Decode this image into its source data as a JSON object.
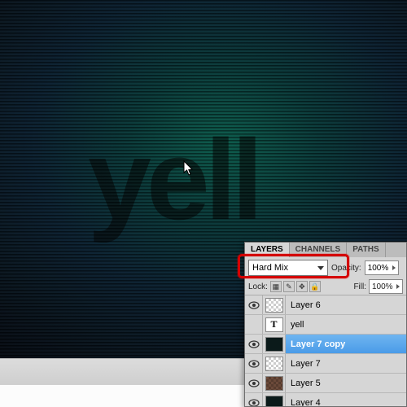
{
  "canvas": {
    "text": "yell"
  },
  "panel": {
    "tabs": [
      "LAYERS",
      "CHANNELS",
      "PATHS"
    ],
    "active_tab": 0,
    "blend_mode": "Hard Mix",
    "opacity_label": "Opacity:",
    "opacity_value": "100%",
    "lock_label": "Lock:",
    "fill_label": "Fill:",
    "fill_value": "100%",
    "layers": [
      {
        "visible": true,
        "type": "checker",
        "name": "Layer 6"
      },
      {
        "visible": false,
        "type": "text",
        "name": "yell",
        "glyph": "T"
      },
      {
        "visible": true,
        "type": "dark-sel",
        "name": "Layer 7 copy",
        "selected": true
      },
      {
        "visible": true,
        "type": "checker",
        "name": "Layer 7"
      },
      {
        "visible": true,
        "type": "checker",
        "name": "Layer 5"
      },
      {
        "visible": true,
        "type": "dark",
        "name": "Layer 4"
      }
    ]
  },
  "colors": {
    "highlight": "#d40000",
    "selection": "#4a9be8"
  }
}
